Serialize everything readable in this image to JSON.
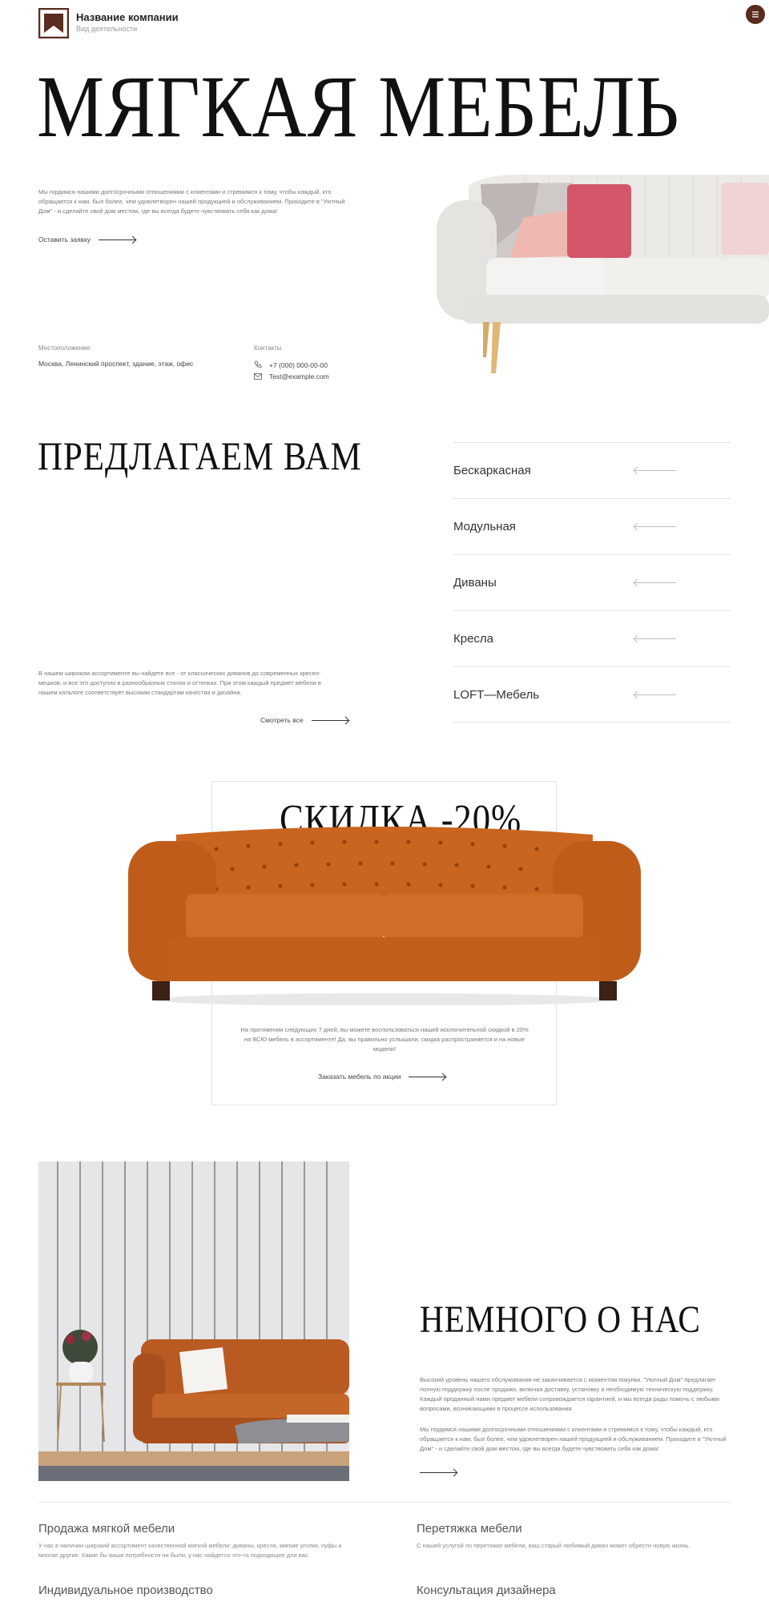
{
  "colors": {
    "brand": "#5a2b1f",
    "accent_text": "#111111",
    "muted": "#777777"
  },
  "header": {
    "company_name": "Название компании",
    "activity": "Вид деятельности",
    "logo_icon": "bookmark-logo-icon",
    "menu_icon": "hamburger-menu-icon"
  },
  "hero": {
    "title": "МЯГКАЯ МЕБЕЛЬ",
    "text": "Мы гордимся нашими долгосрочными отношениями с клиентами и стремимся к тому, чтобы каждый, кто обращается к нам, был более, чем удовлетворен нашей продукцией и обслуживанием. Приходите в \"Уютный Дом\" - и сделайте свой дом местом, где вы всегда будете чувствовать себя как дома!",
    "cta": "Оставить заявку",
    "location_label": "Местоположение:",
    "location_value": "Москва, Ленинский проспект, здание, этаж, офис",
    "contacts_label": "Контакты",
    "phone": "+7 (000) 000-00-00",
    "email": "Test@example.com"
  },
  "offer": {
    "title": "ПРЕДЛАГАЕМ ВАМ",
    "text": "В нашем широком ассортименте вы найдете все - от классических диванов до современных кресел-мешков, и все это доступно в разнообразных стилях и оттенках. При этом каждый предмет мебели в нашем каталоге соответствует высоким стандартам качества и дизайна.",
    "see_all": "Смотреть все",
    "categories": [
      "Бескаркасная",
      "Модульная",
      "Диваны",
      "Кресла",
      "LOFT—Мебель"
    ]
  },
  "sale": {
    "title": "СКИДКА -20%",
    "text": "На протяжении следующих 7 дней, вы можете воспользоваться нашей исключительной скидкой в 20% на ВСЮ мебель в ассортименте! Да, вы правильно услышали, скидка распространяется и на новые модели!",
    "cta": "Заказать мебель по акции"
  },
  "about": {
    "title": "НЕМНОГО О НАС",
    "p1": "Высокий уровень нашего обслуживания не заканчивается с моментом покупки. \"Уютный Дом\" предлагает полную поддержку после продажи, включая доставку, установку и необходимую техническую поддержку. Каждый проданный нами предмет мебели сопровождается гарантией, и мы всегда рады помочь с любыми вопросами, возникающими в процессе использования.",
    "p2": "Мы гордимся нашими долгосрочными отношениями с клиентами и стремимся к тому, чтобы каждый, кто обращается к нам, был более, чем удовлетворен нашей продукцией и обслуживанием. Приходите в \"Уютный Дом\" - и сделайте свой дом местом, где вы всегда будете чувствовать себя как дома!"
  },
  "services": [
    {
      "title": "Продажа мягкой мебели",
      "desc": "У нас в наличии широкий ассортимент качественной мягкой мебели: диваны, кресла, мягкие уголки, пуфы и многие другие. Какие бы ваши потребности ни были, у нас найдется что-то подходящее для вас."
    },
    {
      "title": "Перетяжка мебели",
      "desc": "С нашей услугой по перетяжке мебели, ваш старый любимый диван может обрести новую жизнь."
    },
    {
      "title": "Индивидуальное производство",
      "desc": ""
    },
    {
      "title": "Консультация дизайнера",
      "desc": ""
    }
  ]
}
